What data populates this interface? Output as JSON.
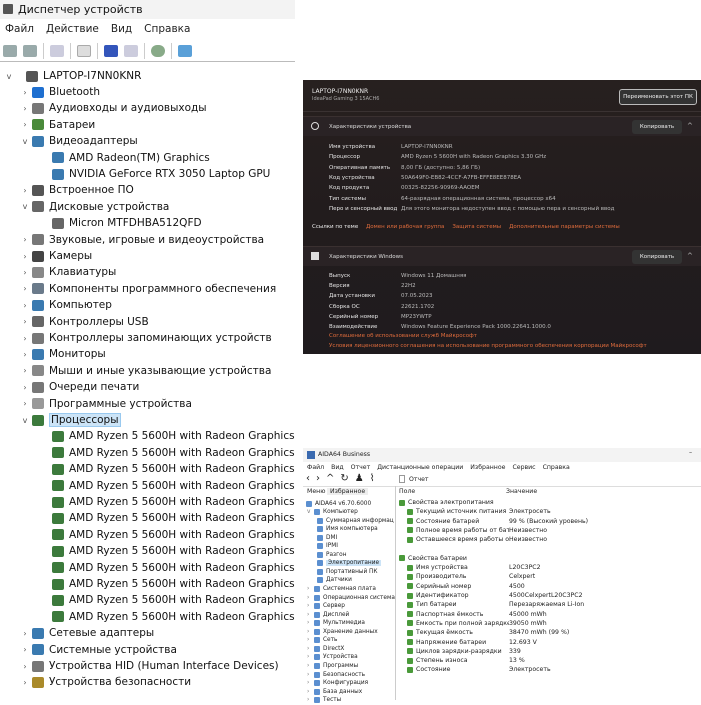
{
  "device_manager": {
    "title": "Диспетчер устройств",
    "menu": [
      "Файл",
      "Действие",
      "Вид",
      "Справка"
    ],
    "root": "LAPTOP-I7NN0KNR",
    "tree": [
      {
        "label": "Bluetooth",
        "level": 1,
        "exp": ">",
        "icon": "bluetooth-icon",
        "color": "#1e6fd0"
      },
      {
        "label": "Аудиовходы и аудиовыходы",
        "level": 1,
        "exp": ">",
        "icon": "audio-icon",
        "color": "#777"
      },
      {
        "label": "Батареи",
        "level": 1,
        "exp": ">",
        "icon": "battery-icon",
        "color": "#4a8a3a"
      },
      {
        "label": "Видеоадаптеры",
        "level": 1,
        "exp": "v",
        "icon": "display-adapter-icon",
        "color": "#3a7ab0"
      },
      {
        "label": "AMD Radeon(TM) Graphics",
        "level": 2,
        "icon": "display-adapter-icon",
        "color": "#3a7ab0"
      },
      {
        "label": "NVIDIA GeForce RTX 3050 Laptop GPU",
        "level": 2,
        "icon": "display-adapter-icon",
        "color": "#3a7ab0"
      },
      {
        "label": "Встроенное ПО",
        "level": 1,
        "exp": ">",
        "icon": "firmware-icon",
        "color": "#555"
      },
      {
        "label": "Дисковые устройства",
        "level": 1,
        "exp": "v",
        "icon": "disk-icon",
        "color": "#666"
      },
      {
        "label": "Micron MTFDHBA512QFD",
        "level": 2,
        "icon": "disk-icon",
        "color": "#666"
      },
      {
        "label": "Звуковые, игровые и видеоустройства",
        "level": 1,
        "exp": ">",
        "icon": "sound-icon",
        "color": "#777"
      },
      {
        "label": "Камеры",
        "level": 1,
        "exp": ">",
        "icon": "camera-icon",
        "color": "#444"
      },
      {
        "label": "Клавиатуры",
        "level": 1,
        "exp": ">",
        "icon": "keyboard-icon",
        "color": "#888"
      },
      {
        "label": "Компоненты программного обеспечения",
        "level": 1,
        "exp": ">",
        "icon": "software-component-icon",
        "color": "#6a7a8a"
      },
      {
        "label": "Компьютер",
        "level": 1,
        "exp": ">",
        "icon": "computer-icon",
        "color": "#3a7ab0"
      },
      {
        "label": "Контроллеры USB",
        "level": 1,
        "exp": ">",
        "icon": "usb-icon",
        "color": "#666"
      },
      {
        "label": "Контроллеры запоминающих устройств",
        "level": 1,
        "exp": ">",
        "icon": "storage-controller-icon",
        "color": "#777"
      },
      {
        "label": "Мониторы",
        "level": 1,
        "exp": ">",
        "icon": "monitor-icon",
        "color": "#3a7ab0"
      },
      {
        "label": "Мыши и иные указывающие устройства",
        "level": 1,
        "exp": ">",
        "icon": "mouse-icon",
        "color": "#888"
      },
      {
        "label": "Очереди печати",
        "level": 1,
        "exp": ">",
        "icon": "printer-icon",
        "color": "#777"
      },
      {
        "label": "Программные устройства",
        "level": 1,
        "exp": ">",
        "icon": "software-device-icon",
        "color": "#999"
      },
      {
        "label": "Процессоры",
        "level": 1,
        "exp": "v",
        "icon": "processor-icon",
        "color": "#3c7a3c",
        "selected": true
      },
      {
        "label": "AMD Ryzen 5 5600H with Radeon Graphics",
        "level": 2,
        "icon": "processor-icon",
        "color": "#3c7a3c"
      },
      {
        "label": "AMD Ryzen 5 5600H with Radeon Graphics",
        "level": 2,
        "icon": "processor-icon",
        "color": "#3c7a3c"
      },
      {
        "label": "AMD Ryzen 5 5600H with Radeon Graphics",
        "level": 2,
        "icon": "processor-icon",
        "color": "#3c7a3c"
      },
      {
        "label": "AMD Ryzen 5 5600H with Radeon Graphics",
        "level": 2,
        "icon": "processor-icon",
        "color": "#3c7a3c"
      },
      {
        "label": "AMD Ryzen 5 5600H with Radeon Graphics",
        "level": 2,
        "icon": "processor-icon",
        "color": "#3c7a3c"
      },
      {
        "label": "AMD Ryzen 5 5600H with Radeon Graphics",
        "level": 2,
        "icon": "processor-icon",
        "color": "#3c7a3c"
      },
      {
        "label": "AMD Ryzen 5 5600H with Radeon Graphics",
        "level": 2,
        "icon": "processor-icon",
        "color": "#3c7a3c"
      },
      {
        "label": "AMD Ryzen 5 5600H with Radeon Graphics",
        "level": 2,
        "icon": "processor-icon",
        "color": "#3c7a3c"
      },
      {
        "label": "AMD Ryzen 5 5600H with Radeon Graphics",
        "level": 2,
        "icon": "processor-icon",
        "color": "#3c7a3c"
      },
      {
        "label": "AMD Ryzen 5 5600H with Radeon Graphics",
        "level": 2,
        "icon": "processor-icon",
        "color": "#3c7a3c"
      },
      {
        "label": "AMD Ryzen 5 5600H with Radeon Graphics",
        "level": 2,
        "icon": "processor-icon",
        "color": "#3c7a3c"
      },
      {
        "label": "AMD Ryzen 5 5600H with Radeon Graphics",
        "level": 2,
        "icon": "processor-icon",
        "color": "#3c7a3c"
      },
      {
        "label": "Сетевые адаптеры",
        "level": 1,
        "exp": ">",
        "icon": "network-adapter-icon",
        "color": "#3a7ab0"
      },
      {
        "label": "Системные устройства",
        "level": 1,
        "exp": ">",
        "icon": "system-device-icon",
        "color": "#3a7ab0"
      },
      {
        "label": "Устройства HID (Human Interface Devices)",
        "level": 1,
        "exp": ">",
        "icon": "hid-icon",
        "color": "#777"
      },
      {
        "label": "Устройства безопасности",
        "level": 1,
        "exp": ">",
        "icon": "security-device-icon",
        "color": "#aa8a2a"
      }
    ]
  },
  "about": {
    "device_name": "LAPTOP-I7NN0KNR",
    "model": "IdeaPad Gaming 3 15ACH6",
    "rename_button": "Переименовать этот ПК",
    "device_section": "Характеристики устройства",
    "copy_label": "Копировать",
    "device_specs": [
      {
        "k": "Имя устройства",
        "v": "LAPTOP-I7NN0KNR"
      },
      {
        "k": "Процессор",
        "v": "AMD Ryzen 5 5600H with Radeon Graphics        3.30 GHz"
      },
      {
        "k": "Оперативная память",
        "v": "8,00 ГБ (доступно: 5,86 ГБ)"
      },
      {
        "k": "Код устройства",
        "v": "50A649F0-EB82-4CCF-A7FB-EFFE8EE878EA"
      },
      {
        "k": "Код продукта",
        "v": "00325-82256-90969-AAOEM"
      },
      {
        "k": "Тип системы",
        "v": "64-разрядная операционная система, процессор x64"
      },
      {
        "k": "Перо и сенсорный ввод",
        "v": "Для этого монитора недоступен ввод с помощью пера и сенсорный ввод"
      }
    ],
    "related_label": "Ссылки по теме",
    "related_links": [
      "Домен или рабочая группа",
      "Защита системы",
      "Дополнительные параметры системы"
    ],
    "windows_section": "Характеристики Windows",
    "windows_specs": [
      {
        "k": "Выпуск",
        "v": "Windows 11 Домашняя"
      },
      {
        "k": "Версия",
        "v": "22H2"
      },
      {
        "k": "Дата установки",
        "v": "07.05.2023"
      },
      {
        "k": "Сборка ОС",
        "v": "22621.1702"
      },
      {
        "k": "Серийный номер",
        "v": "MP23YWTP"
      },
      {
        "k": "Взаимодействие",
        "v": "Windows Feature Experience Pack 1000.22641.1000.0"
      }
    ],
    "legal_links": [
      "Соглашение об использовании служб Майкрософт",
      "Условия лицензионного соглашения на использование программного обеспечения корпорации Майкрософт"
    ]
  },
  "aida": {
    "title": "AIDA64 Business",
    "menu": [
      "Файл",
      "Вид",
      "Отчет",
      "Дистанционные операции",
      "Избранное",
      "Сервис",
      "Справка"
    ],
    "report_label": "Отчет",
    "tabs": [
      "Меню",
      "Избранное"
    ],
    "col_field": "Поле",
    "col_value": "Значение",
    "tree": [
      {
        "label": "AIDA64 v6.70.6000",
        "level": 0
      },
      {
        "label": "Компьютер",
        "level": 1,
        "exp": "v"
      },
      {
        "label": "Суммарная информац",
        "level": 2
      },
      {
        "label": "Имя компьютера",
        "level": 2
      },
      {
        "label": "DMI",
        "level": 2
      },
      {
        "label": "IPMI",
        "level": 2
      },
      {
        "label": "Разгон",
        "level": 2
      },
      {
        "label": "Электропитание",
        "level": 2,
        "selected": true
      },
      {
        "label": "Портативный ПК",
        "level": 2
      },
      {
        "label": "Датчики",
        "level": 2
      },
      {
        "label": "Системная плата",
        "level": 1,
        "exp": ">"
      },
      {
        "label": "Операционная система",
        "level": 1,
        "exp": ">"
      },
      {
        "label": "Сервер",
        "level": 1,
        "exp": ">"
      },
      {
        "label": "Дисплей",
        "level": 1,
        "exp": ">"
      },
      {
        "label": "Мультимедиа",
        "level": 1,
        "exp": ">"
      },
      {
        "label": "Хранение данных",
        "level": 1,
        "exp": ">"
      },
      {
        "label": "Сеть",
        "level": 1,
        "exp": ">"
      },
      {
        "label": "DirectX",
        "level": 1,
        "exp": ">"
      },
      {
        "label": "Устройства",
        "level": 1,
        "exp": ">"
      },
      {
        "label": "Программы",
        "level": 1,
        "exp": ">"
      },
      {
        "label": "Безопасность",
        "level": 1,
        "exp": ">"
      },
      {
        "label": "Конфигурация",
        "level": 1,
        "exp": ">"
      },
      {
        "label": "База данных",
        "level": 1,
        "exp": ">"
      },
      {
        "label": "Тесты",
        "level": 1,
        "exp": ">"
      }
    ],
    "rows": [
      {
        "group": "Свойства электропитания"
      },
      {
        "k": "Текущий источник питания",
        "v": "Электросеть"
      },
      {
        "k": "Состояние батарей",
        "v": "99 % (Высокий уровень)"
      },
      {
        "k": "Полное время работы от бата...",
        "v": "Неизвестно"
      },
      {
        "k": "Оставшееся время работы от ...",
        "v": "Неизвестно"
      },
      {
        "blank": true
      },
      {
        "group": "Свойства батареи"
      },
      {
        "k": "Имя устройства",
        "v": "L20C3PC2"
      },
      {
        "k": "Производитель",
        "v": "Celxpert"
      },
      {
        "k": "Серийный номер",
        "v": "4500"
      },
      {
        "k": "Идентификатор",
        "v": "4500CelxpertL20C3PC2"
      },
      {
        "k": "Тип батареи",
        "v": "Перезаряжаемая Li-Ion"
      },
      {
        "k": "Паспортная ёмкость",
        "v": "45000 mWh"
      },
      {
        "k": "Ёмкость при полной зарядке",
        "v": "39050 mWh"
      },
      {
        "k": "Текущая ёмкость",
        "v": "38470 mWh  (99 %)"
      },
      {
        "k": "Напряжение батареи",
        "v": "12.693 V"
      },
      {
        "k": "Циклов зарядки-разрядки",
        "v": "339"
      },
      {
        "k": "Степень износа",
        "v": "13 %"
      },
      {
        "k": "Состояние",
        "v": "Электросеть"
      }
    ]
  }
}
